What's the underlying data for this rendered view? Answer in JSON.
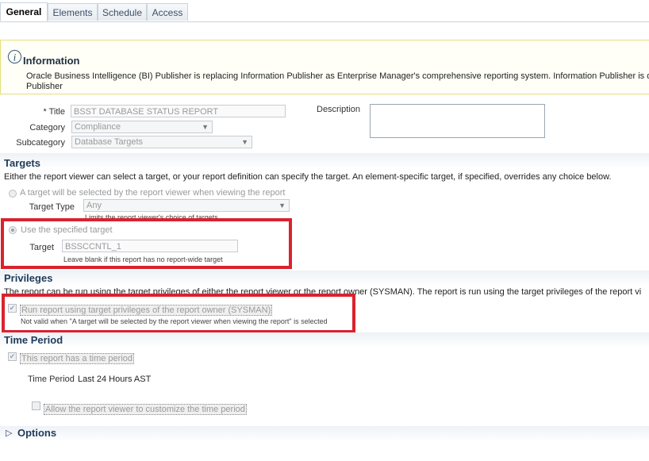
{
  "tabs": [
    "General",
    "Elements",
    "Schedule",
    "Access"
  ],
  "info": {
    "title": "Information",
    "line1": "Oracle Business Intelligence (BI) Publisher is replacing Information Publisher as Enterprise Manager's comprehensive reporting system. Information Publisher is d",
    "line2": "Publisher"
  },
  "general": {
    "title_label": "* Title",
    "title_value": "BSST DATABASE STATUS REPORT",
    "category_label": "Category",
    "category_value": "Compliance",
    "subcategory_label": "Subcategory",
    "subcategory_value": "Database Targets",
    "description_label": "Description"
  },
  "targets": {
    "title": "Targets",
    "description": "Either the report viewer can select a target, or your report definition can specify the target. An element-specific target, if specified, overrides any choice below.",
    "option_viewer": "A target will be selected by the report viewer when viewing the report",
    "target_type_label": "Target Type",
    "target_type_value": "Any",
    "target_type_hint": "Limits the report viewer's choice of targets",
    "option_specified": "Use the specified target",
    "target_label": "Target",
    "target_value": "BSSCCNTL_1",
    "target_hint": "Leave blank if this report has no report-wide target"
  },
  "privileges": {
    "title": "Privileges",
    "description": "The report can be run using the target privileges of either the report viewer or the report owner (SYSMAN). The report is run using the target privileges of the report vi",
    "checkbox_label": "Run report using target privileges of the report owner (SYSMAN)",
    "checkbox_hint": "Not valid when \"A target will be selected by the report viewer when viewing the report\" is selected"
  },
  "time_period": {
    "title": "Time Period",
    "checkbox_label": "This report has a time period",
    "period_label": "Time Period",
    "period_value": "Last 24 Hours AST",
    "customize_label": "Allow the report viewer to customize the time period"
  },
  "options": {
    "title": "Options"
  },
  "colors": {
    "highlight": "#d9232e",
    "section_title": "#1e3b5a",
    "info_border": "#e4e07a"
  }
}
